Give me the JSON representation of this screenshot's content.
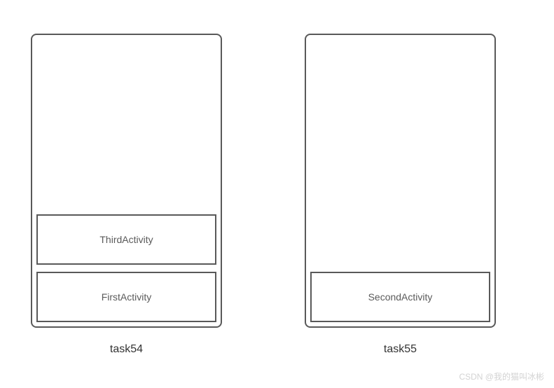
{
  "tasks": [
    {
      "label": "task54",
      "activities": [
        {
          "name": "ThirdActivity"
        },
        {
          "name": "FirstActivity"
        }
      ]
    },
    {
      "label": "task55",
      "activities": [
        {
          "name": "SecondActivity"
        }
      ]
    }
  ],
  "watermark": "CSDN @我的猫叫冰彬"
}
